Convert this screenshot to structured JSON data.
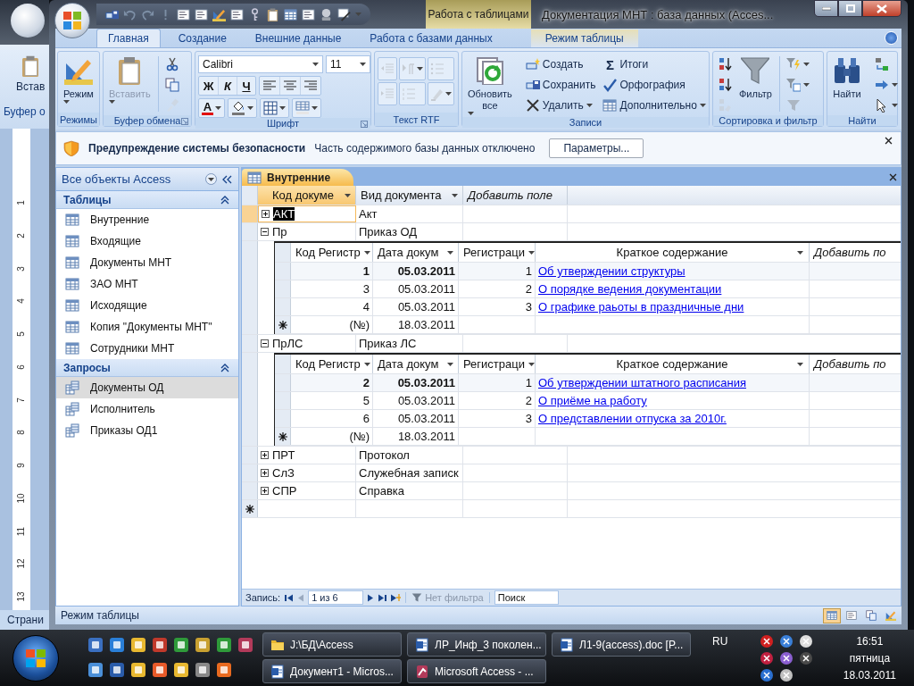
{
  "background_window": {
    "ribbon_button": "Встав",
    "group_label": "Буфер о",
    "ruler_numbers": [
      "1",
      "2",
      "3",
      "4",
      "5",
      "6",
      "7",
      "8",
      "9",
      "10",
      "11",
      "12",
      "13"
    ],
    "status_text": "Страни"
  },
  "window": {
    "title": "Документация МНТ : база данных (Acces...",
    "context_group": "Работа с таблицами"
  },
  "ribbon": {
    "tabs": [
      {
        "label": "Главная",
        "selected": true,
        "kind": "main"
      },
      {
        "label": "Создание",
        "selected": false,
        "kind": "main"
      },
      {
        "label": "Внешние данные",
        "selected": false,
        "kind": "main"
      },
      {
        "label": "Работа с базами данных",
        "selected": false,
        "kind": "main"
      },
      {
        "label": "Режим таблицы",
        "selected": false,
        "kind": "contextual"
      }
    ],
    "groups": [
      {
        "label": "Режимы",
        "kind": "buttons",
        "launcher": false,
        "buttons": [
          {
            "kind": "large",
            "label": "Режим",
            "dropdown": true,
            "disabled": false
          }
        ]
      },
      {
        "label": "Буфер обмена",
        "kind": "buttons",
        "launcher": true,
        "buttons": [
          {
            "kind": "large",
            "label": "Вставить",
            "dropdown": true,
            "disabled": true
          },
          {
            "kind": "small",
            "dropdown": false,
            "disabled": false
          },
          {
            "kind": "small",
            "dropdown": false,
            "disabled": false
          },
          {
            "kind": "small",
            "dropdown": false,
            "disabled": true
          }
        ]
      },
      {
        "label": "Шрифт",
        "kind": "font",
        "launcher": true,
        "font": "Calibri",
        "size": "11",
        "styles": [
          "Ж",
          "К",
          "Ч"
        ],
        "font_color": "A"
      },
      {
        "label": "Текст RTF",
        "kind": "rtf",
        "launcher": false,
        "buttons": [
          {
            "kind": "small",
            "dropdown": false,
            "disabled": true
          },
          {
            "kind": "small",
            "dropdown": false,
            "disabled": true
          },
          {
            "kind": "small",
            "dropdown": true,
            "disabled": true
          },
          {
            "kind": "small",
            "dropdown": false,
            "disabled": true
          },
          {
            "kind": "small",
            "dropdown": false,
            "disabled": true
          },
          {
            "kind": "small",
            "dropdown": true,
            "disabled": true
          }
        ]
      },
      {
        "label": "Записи",
        "kind": "buttons",
        "launcher": false,
        "buttons": [
          {
            "kind": "large",
            "label": "Обновить все",
            "dropdown": true,
            "disabled": false
          },
          {
            "kind": "small",
            "label": "Создать",
            "dropdown": false,
            "disabled": false
          },
          {
            "kind": "small",
            "label": "Сохранить",
            "dropdown": false,
            "disabled": false
          },
          {
            "kind": "small",
            "label": "Удалить",
            "dropdown": true,
            "disabled": false
          },
          {
            "kind": "small",
            "label": "Итоги",
            "symbol": "Σ",
            "dropdown": false,
            "disabled": false
          },
          {
            "kind": "small",
            "label": "Орфография",
            "dropdown": false,
            "disabled": false
          },
          {
            "kind": "small",
            "label": "Дополнительно",
            "dropdown": true,
            "disabled": false
          }
        ]
      },
      {
        "label": "Сортировка и фильтр",
        "kind": "buttons",
        "launcher": false,
        "buttons": [
          {
            "kind": "small",
            "dropdown": false,
            "disabled": false
          },
          {
            "kind": "small",
            "dropdown": false,
            "disabled": false
          },
          {
            "kind": "small",
            "dropdown": false,
            "disabled": true
          },
          {
            "kind": "large",
            "label": "Фильтр",
            "dropdown": false,
            "disabled": false
          },
          {
            "kind": "small",
            "dropdown": true,
            "disabled": false
          },
          {
            "kind": "small",
            "dropdown": true,
            "disabled": false
          },
          {
            "kind": "small",
            "dropdown": false,
            "disabled": true
          }
        ]
      },
      {
        "label": "Найти",
        "kind": "buttons",
        "launcher": false,
        "buttons": [
          {
            "kind": "large",
            "label": "Найти",
            "dropdown": false,
            "disabled": false
          },
          {
            "kind": "small",
            "dropdown": false,
            "disabled": false
          },
          {
            "kind": "small",
            "dropdown": true,
            "disabled": false
          },
          {
            "kind": "small",
            "dropdown": true,
            "disabled": false
          }
        ]
      }
    ]
  },
  "security_bar": {
    "title": "Предупреждение системы безопасности",
    "message": "Часть содержимого базы данных отключено",
    "button": "Параметры..."
  },
  "navigation_pane": {
    "header": "Все объекты Access",
    "sections": [
      {
        "title": "Таблицы",
        "kind": "table",
        "expanded": true,
        "items": [
          {
            "label": "Внутренние",
            "selected": false
          },
          {
            "label": "Входящие",
            "selected": false
          },
          {
            "label": "Документы МНТ",
            "selected": false
          },
          {
            "label": "ЗАО МНТ",
            "selected": false
          },
          {
            "label": "Исходящие",
            "selected": false
          },
          {
            "label": "Копия \"Документы МНТ\"",
            "selected": false
          },
          {
            "label": "Сотрудники МНТ",
            "selected": false
          }
        ]
      },
      {
        "title": "Запросы",
        "kind": "query",
        "expanded": true,
        "items": [
          {
            "label": "Документы ОД",
            "selected": true
          },
          {
            "label": "Исполнитель",
            "selected": false
          },
          {
            "label": "Приказы ОД1",
            "selected": false
          }
        ]
      }
    ]
  },
  "document_tab": {
    "label": "Внутренние"
  },
  "datasheet": {
    "columns": [
      {
        "label": "Код докуме",
        "kind": "field",
        "selected": true
      },
      {
        "label": "Вид документа",
        "kind": "field",
        "selected": false
      },
      {
        "label": "Добавить поле",
        "kind": "add",
        "selected": false
      }
    ],
    "rows": [
      {
        "code": "АКТ",
        "type": "Акт",
        "expanded": false,
        "selected": true
      },
      {
        "code": "Пр",
        "type": "Приказ ОД",
        "expanded": true,
        "selected": false,
        "records": {
          "columns": [
            {
              "label": "Код Регистр",
              "kind": "id"
            },
            {
              "label": "Дата докум",
              "kind": "date"
            },
            {
              "label": "Регистраци",
              "kind": "number"
            },
            {
              "label": "Краткое содержание",
              "kind": "hyperlink"
            },
            {
              "label": "Добавить по",
              "kind": "add"
            }
          ],
          "rows": [
            {
              "cells": [
                "1",
                "05.03.2011",
                "1",
                "Об утверждении структуры"
              ],
              "current": true
            },
            {
              "cells": [
                "3",
                "05.03.2011",
                "2",
                "О порядке ведения документации"
              ],
              "current": false
            },
            {
              "cells": [
                "4",
                "05.03.2011",
                "3",
                "О графике раьоты в праздничные дни"
              ],
              "current": false
            }
          ],
          "new_row": [
            "(№)",
            "18.03.2011"
          ]
        }
      },
      {
        "code": "ПрЛС",
        "type": "Приказ ЛС",
        "expanded": true,
        "selected": false,
        "records": {
          "columns": [
            {
              "label": "Код Регистр",
              "kind": "id"
            },
            {
              "label": "Дата докум",
              "kind": "date"
            },
            {
              "label": "Регистраци",
              "kind": "number"
            },
            {
              "label": "Краткое содержание",
              "kind": "hyperlink"
            },
            {
              "label": "Добавить по",
              "kind": "add"
            }
          ],
          "rows": [
            {
              "cells": [
                "2",
                "05.03.2011",
                "1",
                "Об утверждении штатного расписания"
              ],
              "current": true
            },
            {
              "cells": [
                "5",
                "05.03.2011",
                "2",
                "О приёме на работу"
              ],
              "current": false
            },
            {
              "cells": [
                "6",
                "05.03.2011",
                "3",
                "О представлении отпуска за 2010г."
              ],
              "current": false
            }
          ],
          "new_row": [
            "(№)",
            "18.03.2011"
          ]
        }
      },
      {
        "code": "ПРТ",
        "type": "Протокол",
        "expanded": false,
        "selected": false
      },
      {
        "code": "СлЗ",
        "type": "Служебная записк",
        "expanded": false,
        "selected": false
      },
      {
        "code": "СПР",
        "type": "Справка",
        "expanded": false,
        "selected": false
      }
    ]
  },
  "record_navigator": {
    "label": "Запись:",
    "position": "1 из 6",
    "filter": "Нет фильтра",
    "search_placeholder": "Поиск"
  },
  "status_bar": {
    "text": "Режим таблицы",
    "views": [
      {
        "selected": true
      },
      {
        "selected": false
      },
      {
        "selected": false
      },
      {
        "selected": false
      }
    ]
  },
  "taskbar": {
    "tasks": [
      {
        "label": "J:\\БД\\Access",
        "kind": "folder",
        "selected": false
      },
      {
        "label": "ЛР_Инф_3 поколен...",
        "kind": "document",
        "selected": false
      },
      {
        "label": "Л1-9(access).doc [P...",
        "kind": "document",
        "selected": false
      },
      {
        "label": "Документ1 - Micros...",
        "kind": "document",
        "selected": false
      },
      {
        "label": "Microsoft Access - ...",
        "kind": "access",
        "selected": false
      }
    ],
    "language": "RU",
    "clock": {
      "time": "16:51",
      "day": "пятница",
      "date": "18.03.2011"
    }
  }
}
